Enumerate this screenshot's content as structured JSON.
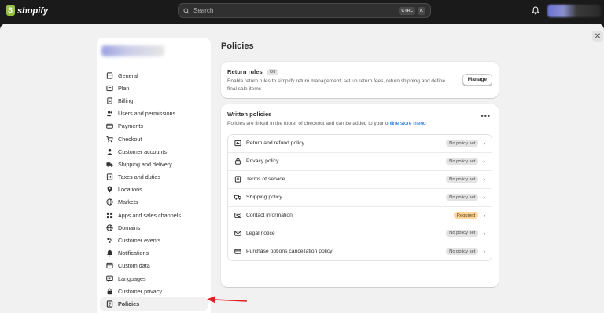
{
  "app": {
    "brand": "shopify"
  },
  "search": {
    "placeholder": "Search",
    "shortcut_1": "CTRL",
    "shortcut_2": "K"
  },
  "icons": {
    "search": "search-icon",
    "bell": "bell-icon",
    "close": "close-icon",
    "chevron": "chevron-right-icon",
    "more": "more-horizontal-icon"
  },
  "sidebar": {
    "items": [
      {
        "label": "General",
        "icon": "store-icon"
      },
      {
        "label": "Plan",
        "icon": "plan-icon"
      },
      {
        "label": "Billing",
        "icon": "billing-icon"
      },
      {
        "label": "Users and permissions",
        "icon": "users-icon"
      },
      {
        "label": "Payments",
        "icon": "payments-icon"
      },
      {
        "label": "Checkout",
        "icon": "cart-icon"
      },
      {
        "label": "Customer accounts",
        "icon": "person-icon"
      },
      {
        "label": "Shipping and delivery",
        "icon": "truck-icon"
      },
      {
        "label": "Taxes and duties",
        "icon": "tax-icon"
      },
      {
        "label": "Locations",
        "icon": "location-icon"
      },
      {
        "label": "Markets",
        "icon": "globe-icon"
      },
      {
        "label": "Apps and sales channels",
        "icon": "apps-icon"
      },
      {
        "label": "Domains",
        "icon": "globe-icon"
      },
      {
        "label": "Customer events",
        "icon": "events-icon"
      },
      {
        "label": "Notifications",
        "icon": "bell-icon"
      },
      {
        "label": "Custom data",
        "icon": "data-icon"
      },
      {
        "label": "Languages",
        "icon": "language-icon"
      },
      {
        "label": "Customer privacy",
        "icon": "lock-icon"
      },
      {
        "label": "Policies",
        "icon": "policies-icon",
        "active": true
      }
    ]
  },
  "page": {
    "title": "Policies"
  },
  "return_rules": {
    "title": "Return rules",
    "status": "Off",
    "description": "Enable return rules to simplify return management, set up return fees, return shipping and define final sale items",
    "button": "Manage"
  },
  "written_policies": {
    "title": "Written policies",
    "description": "Policies are linked in the footer of checkout and can be added to your",
    "link": "online store menu",
    "rows": [
      {
        "label": "Return and refund policy",
        "status": "No policy set",
        "icon": "return-icon"
      },
      {
        "label": "Privacy policy",
        "status": "No policy set",
        "icon": "lock-icon"
      },
      {
        "label": "Terms of service",
        "status": "No policy set",
        "icon": "document-icon"
      },
      {
        "label": "Shipping policy",
        "status": "No policy set",
        "icon": "truck-icon"
      },
      {
        "label": "Contact information",
        "status": "Required",
        "icon": "contact-icon"
      },
      {
        "label": "Legal notice",
        "status": "No policy set",
        "icon": "mail-icon"
      },
      {
        "label": "Purchase options cancellation policy",
        "status": "No policy set",
        "icon": "card-icon"
      }
    ]
  },
  "colors": {
    "accent_arrow": "#e02020",
    "link": "#005bd3",
    "required_badge": "#ffd6a4"
  }
}
